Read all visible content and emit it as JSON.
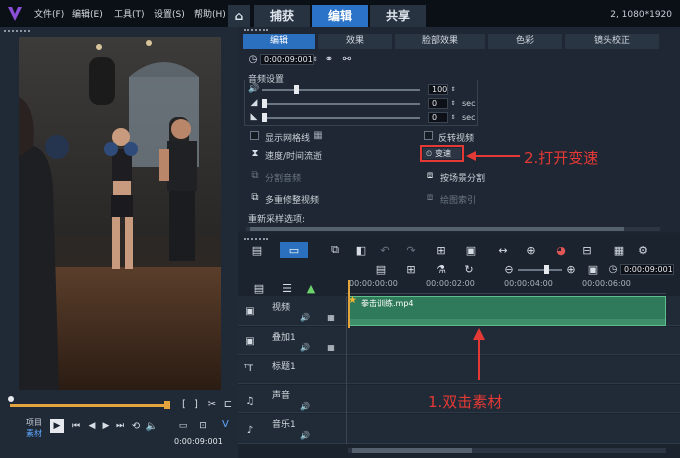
{
  "menu": [
    "文件(F)",
    "编辑(E)",
    "工具(T)",
    "设置(S)",
    "帮助(H)"
  ],
  "top_tabs": [
    {
      "label": "⌂",
      "active": false
    },
    {
      "label": "捕获",
      "active": false
    },
    {
      "label": "编辑",
      "active": true
    },
    {
      "label": "共享",
      "active": false
    }
  ],
  "resolution": "2, 1080*1920",
  "sub_tabs": [
    "编辑",
    "效果",
    "脸部效果",
    "色彩",
    "镜头校正"
  ],
  "editor": {
    "duration": "0:00:09:001",
    "audio_settings_label": "音频设置",
    "volume": "100",
    "fade_in": "0",
    "fade_out": "0",
    "sec": "sec",
    "show_grid": "显示网格线",
    "reverse_video": "反转视频",
    "speed_time": "速度/时间流逝",
    "speed_button": "变速",
    "split_audio": "分割音频",
    "split_by_scene": "按场景分割",
    "multi_trim": "多重修整视频",
    "extract_index": "绘图索引",
    "resample_label": "重新采样选项:"
  },
  "annotations": {
    "step2": "2.打开变速",
    "step1": "1.双击素材"
  },
  "playback": {
    "project": "项目",
    "clip": "素材",
    "timecode": "0:00:09:001"
  },
  "timeline": {
    "ruler": [
      "00:00:00:00",
      "00:00:02:00",
      "00:00:04:00",
      "00:00:06:00"
    ],
    "timecode": "0:00:09:001",
    "tracks": [
      {
        "name": "视频",
        "clip": "拳击训练.mp4"
      },
      {
        "name": "叠加1"
      },
      {
        "name": "标题1"
      },
      {
        "name": "声音"
      },
      {
        "name": "音乐1"
      }
    ]
  },
  "colors": {
    "accent": "#2b6fbf",
    "clip_green": "#2f7a5a",
    "annotation_red": "#e53935",
    "scrubber": "#e2a43d"
  }
}
